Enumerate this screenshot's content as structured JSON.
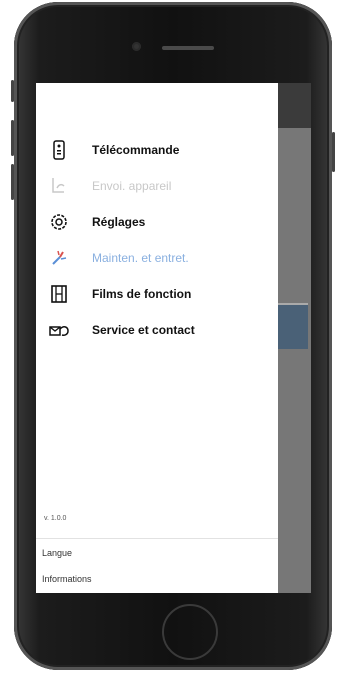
{
  "drawer": {
    "items": [
      {
        "label": "Télécommande",
        "icon": "remote-icon",
        "state": "normal"
      },
      {
        "label": "Envoi. appareil",
        "icon": "pairing-icon",
        "state": "disabled"
      },
      {
        "label": "Réglages",
        "icon": "gear-icon",
        "state": "normal"
      },
      {
        "label": "Mainten. et entret.",
        "icon": "maintenance-icon",
        "state": "highlighted"
      },
      {
        "label": "Films de fonction",
        "icon": "film-icon",
        "state": "normal"
      },
      {
        "label": "Service et contact",
        "icon": "contact-icon",
        "state": "normal"
      }
    ],
    "version": "v. 1.0.0",
    "footer": {
      "language": "Langue",
      "info": "Informations"
    }
  },
  "colors": {
    "accent": "#8ab0e0",
    "disabled": "#c8c8c8",
    "text": "#111111",
    "overlay": "#6c6c6c"
  }
}
